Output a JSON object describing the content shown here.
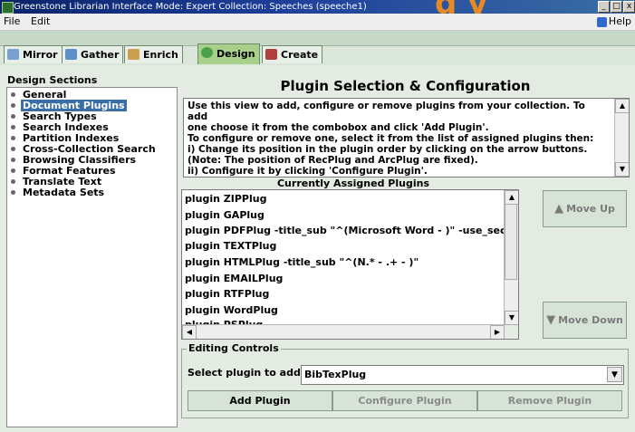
{
  "window": {
    "title": "Greenstone Librarian Interface  Mode: Expert  Collection: Speeches (speeche1)",
    "overlay_text": "g              y",
    "controls": [
      "_",
      "□",
      "x"
    ]
  },
  "menu": {
    "file_label": "File",
    "edit_label": "Edit",
    "help_label": "Help"
  },
  "tabs": [
    {
      "label": "Mirror",
      "icon": "mirror-icon"
    },
    {
      "label": "Gather",
      "icon": "gather-icon"
    },
    {
      "label": "Enrich",
      "icon": "enrich-icon"
    },
    {
      "label": "Design",
      "icon": "design-icon",
      "active": true
    },
    {
      "label": "Create",
      "icon": "create-icon"
    }
  ],
  "sidebar": {
    "title": "Design Sections",
    "items": [
      {
        "label": "General"
      },
      {
        "label": "Document Plugins",
        "selected": true
      },
      {
        "label": "Search Types"
      },
      {
        "label": "Search Indexes"
      },
      {
        "label": "Partition Indexes"
      },
      {
        "label": "Cross-Collection Search"
      },
      {
        "label": "Browsing Classifiers"
      },
      {
        "label": "Format Features"
      },
      {
        "label": "Translate Text"
      },
      {
        "label": "Metadata Sets"
      }
    ]
  },
  "main": {
    "heading": "Plugin Selection & Configuration",
    "description": [
      "Use this view to add, configure or remove plugins from your collection. To add",
      "one choose it from the combobox and click 'Add Plugin'.",
      "To configure or remove one, select it from the list of assigned plugins then:",
      "i)   Change its position in the plugin order by clicking on the arrow buttons.",
      "(Note: The position of RecPlug and ArcPlug are fixed).",
      "ii)  Configure it by clicking 'Configure Plugin'."
    ],
    "assigned_label": "Currently Assigned Plugins",
    "plugins": [
      "plugin ZIPPlug",
      "plugin GAPlug",
      "plugin PDFPlug -title_sub \"^(Microsoft Word - )\" -use_secti",
      "plugin TEXTPlug",
      "plugin HTMLPlug -title_sub \"^(N.* - .+ - )\"",
      "plugin EMAILPlug",
      "plugin RTFPlug",
      "plugin WordPlug",
      "plugin PSPlug"
    ],
    "move_up_label": "Move Up",
    "move_down_label": "Move Down"
  },
  "editing": {
    "title": "Editing Controls",
    "select_label": "Select plugin to add:",
    "select_value": "BibTexPlug",
    "add_label": "Add Plugin",
    "configure_label": "Configure Plugin",
    "remove_label": "Remove Plugin"
  },
  "colors": {
    "titlebar": "#0a246a",
    "panel_bg": "#e3ebe3",
    "active_tab": "#a9d08a",
    "selection": "#3a6ea5"
  }
}
